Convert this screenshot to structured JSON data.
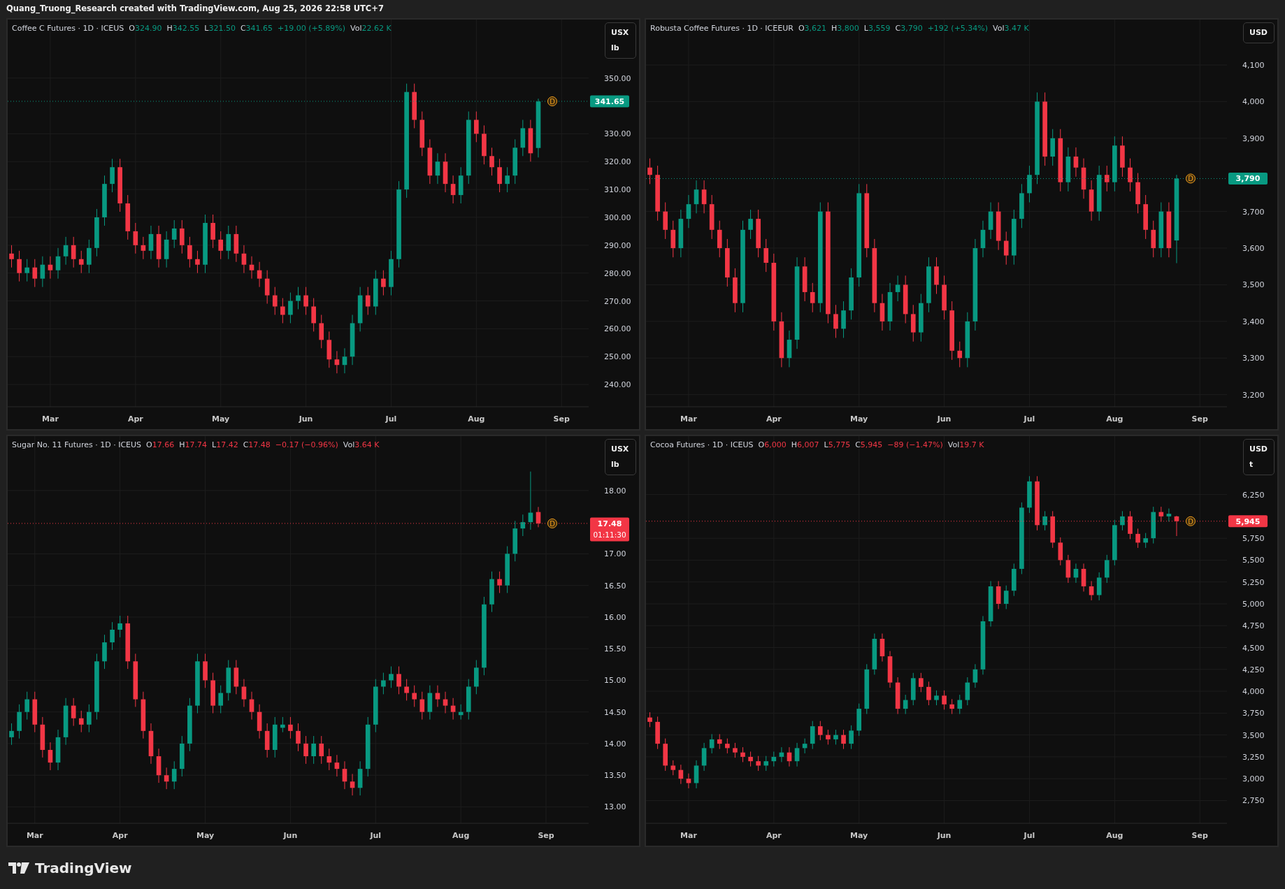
{
  "header": {
    "title": "Quang_Truong_Research created with TradingView.com, Aug 25, 2026 22:58 UTC+7"
  },
  "panels": [
    {
      "symbol": "Coffee C Futures · 1D · ICEUS",
      "rising": true,
      "ohlc": [
        {
          "label": "O",
          "value": "324.90"
        },
        {
          "label": "H",
          "value": "342.55"
        },
        {
          "label": "L",
          "value": "321.50"
        },
        {
          "label": "C",
          "value": "341.65"
        }
      ],
      "change": "+19.00 (+5.89%)",
      "volume_label": "Vol",
      "volume": "22.62 K",
      "currency": "USX",
      "unit": "lb",
      "marker": "D",
      "chart_data": {
        "type": "candlestick",
        "grid": true,
        "ylim": [
          232,
          371
        ],
        "categories": [
          null,
          null,
          null,
          null,
          null,
          "Mar",
          null,
          null,
          null,
          null,
          null,
          null,
          null,
          null,
          null,
          null,
          "Apr",
          null,
          null,
          null,
          null,
          null,
          null,
          null,
          null,
          null,
          null,
          "May",
          null,
          null,
          null,
          null,
          null,
          null,
          null,
          null,
          null,
          null,
          "Jun",
          null,
          null,
          null,
          null,
          null,
          null,
          null,
          null,
          null,
          null,
          "Jul",
          null,
          null,
          null,
          null,
          null,
          null,
          null,
          null,
          null,
          null,
          "Aug",
          null,
          null,
          null,
          null,
          null,
          null,
          null,
          null,
          null,
          null,
          "Sep",
          null,
          null,
          null
        ],
        "yticks": [
          {
            "value": 240,
            "label": "240.00"
          },
          {
            "value": 250,
            "label": "250.00"
          },
          {
            "value": 260,
            "label": "260.00"
          },
          {
            "value": 270,
            "label": "270.00"
          },
          {
            "value": 280,
            "label": "280.00"
          },
          {
            "value": 290,
            "label": "290.00"
          },
          {
            "value": 300,
            "label": "300.00"
          },
          {
            "value": 310,
            "label": "310.00"
          },
          {
            "value": 320,
            "label": "320.00"
          },
          {
            "value": 330,
            "label": "330.00"
          },
          {
            "value": 350,
            "label": "350.00"
          }
        ],
        "ref_lines": [
          {
            "axis": "y",
            "value": 341.65,
            "label": "341.65"
          }
        ],
        "ohlc": [
          [
            287,
            290,
            282,
            285
          ],
          [
            285,
            288,
            277,
            280
          ],
          [
            280,
            285,
            277,
            282
          ],
          [
            282,
            285,
            275,
            278
          ],
          [
            278,
            286,
            275,
            283
          ],
          [
            283,
            286,
            278,
            281
          ],
          [
            281,
            289,
            278,
            286
          ],
          [
            286,
            293,
            283,
            290
          ],
          [
            290,
            293,
            282,
            285
          ],
          [
            285,
            288,
            280,
            283
          ],
          [
            283,
            292,
            280,
            289
          ],
          [
            289,
            303,
            286,
            300
          ],
          [
            300,
            315,
            297,
            312
          ],
          [
            312,
            321,
            309,
            318
          ],
          [
            318,
            321,
            302,
            305
          ],
          [
            305,
            308,
            292,
            295
          ],
          [
            295,
            298,
            287,
            290
          ],
          [
            290,
            293,
            285,
            288
          ],
          [
            288,
            297,
            285,
            294
          ],
          [
            294,
            297,
            282,
            285
          ],
          [
            285,
            295,
            282,
            292
          ],
          [
            292,
            299,
            289,
            296
          ],
          [
            296,
            299,
            287,
            290
          ],
          [
            290,
            293,
            282,
            285
          ],
          [
            285,
            288,
            280,
            283
          ],
          [
            283,
            301,
            280,
            298
          ],
          [
            298,
            301,
            289,
            292
          ],
          [
            292,
            295,
            285,
            288
          ],
          [
            288,
            297,
            285,
            294
          ],
          [
            294,
            297,
            284,
            287
          ],
          [
            287,
            290,
            280,
            283
          ],
          [
            283,
            286,
            278,
            281
          ],
          [
            281,
            284,
            275,
            278
          ],
          [
            278,
            281,
            269,
            272
          ],
          [
            272,
            275,
            265,
            268
          ],
          [
            268,
            271,
            262,
            265
          ],
          [
            265,
            273,
            262,
            270
          ],
          [
            270,
            275,
            267,
            272
          ],
          [
            272,
            275,
            265,
            268
          ],
          [
            268,
            271,
            259,
            262
          ],
          [
            262,
            265,
            253,
            256
          ],
          [
            256,
            259,
            246,
            249
          ],
          [
            249,
            252,
            244,
            247
          ],
          [
            247,
            253,
            244,
            250
          ],
          [
            250,
            265,
            247,
            262
          ],
          [
            262,
            275,
            259,
            272
          ],
          [
            272,
            275,
            265,
            268
          ],
          [
            268,
            281,
            265,
            278
          ],
          [
            278,
            281,
            272,
            275
          ],
          [
            275,
            288,
            272,
            285
          ],
          [
            285,
            313,
            282,
            310
          ],
          [
            310,
            348,
            307,
            345
          ],
          [
            345,
            348,
            332,
            335
          ],
          [
            335,
            338,
            322,
            325
          ],
          [
            325,
            328,
            312,
            315
          ],
          [
            315,
            323,
            312,
            320
          ],
          [
            320,
            323,
            309,
            312
          ],
          [
            312,
            315,
            305,
            308
          ],
          [
            308,
            318,
            305,
            315
          ],
          [
            315,
            338,
            312,
            335
          ],
          [
            335,
            338,
            327,
            330
          ],
          [
            330,
            333,
            319,
            322
          ],
          [
            322,
            325,
            315,
            318
          ],
          [
            318,
            321,
            309,
            312
          ],
          [
            312,
            318,
            309,
            315
          ],
          [
            315,
            328,
            312,
            325
          ],
          [
            325,
            335,
            322,
            332
          ],
          [
            332,
            335,
            320,
            323
          ],
          [
            324.9,
            342.6,
            321.5,
            341.6
          ],
          null,
          null,
          null,
          null,
          null,
          null
        ]
      }
    },
    {
      "symbol": "Robusta Coffee Futures · 1D · ICEEUR",
      "rising": true,
      "ohlc": [
        {
          "label": "O",
          "value": "3,621"
        },
        {
          "label": "H",
          "value": "3,800"
        },
        {
          "label": "L",
          "value": "3,559"
        },
        {
          "label": "C",
          "value": "3,790"
        }
      ],
      "change": "+192 (+5.34%)",
      "volume_label": "Vol",
      "volume": "3.47 K",
      "currency": "USD",
      "marker": "D",
      "chart_data": {
        "type": "candlestick",
        "grid": true,
        "ylim": [
          3167,
          4224
        ],
        "categories": [
          null,
          null,
          null,
          null,
          null,
          "Mar",
          null,
          null,
          null,
          null,
          null,
          null,
          null,
          null,
          null,
          null,
          "Apr",
          null,
          null,
          null,
          null,
          null,
          null,
          null,
          null,
          null,
          null,
          "May",
          null,
          null,
          null,
          null,
          null,
          null,
          null,
          null,
          null,
          null,
          "Jun",
          null,
          null,
          null,
          null,
          null,
          null,
          null,
          null,
          null,
          null,
          "Jul",
          null,
          null,
          null,
          null,
          null,
          null,
          null,
          null,
          null,
          null,
          "Aug",
          null,
          null,
          null,
          null,
          null,
          null,
          null,
          null,
          null,
          null,
          "Sep",
          null,
          null,
          null
        ],
        "yticks": [
          {
            "value": 3200,
            "label": "3,200"
          },
          {
            "value": 3300,
            "label": "3,300"
          },
          {
            "value": 3400,
            "label": "3,400"
          },
          {
            "value": 3500,
            "label": "3,500"
          },
          {
            "value": 3600,
            "label": "3,600"
          },
          {
            "value": 3700,
            "label": "3,700"
          },
          {
            "value": 3900,
            "label": "3,900"
          },
          {
            "value": 4000,
            "label": "4,000"
          },
          {
            "value": 4100,
            "label": "4,100"
          }
        ],
        "ref_lines": [
          {
            "axis": "y",
            "value": 3790,
            "label": "3,790"
          }
        ],
        "ohlc": [
          [
            3820,
            3845,
            3775,
            3800
          ],
          [
            3800,
            3825,
            3675,
            3700
          ],
          [
            3700,
            3725,
            3625,
            3650
          ],
          [
            3650,
            3675,
            3575,
            3600
          ],
          [
            3600,
            3705,
            3575,
            3680
          ],
          [
            3680,
            3745,
            3655,
            3720
          ],
          [
            3720,
            3785,
            3695,
            3760
          ],
          [
            3760,
            3785,
            3695,
            3720
          ],
          [
            3720,
            3745,
            3625,
            3650
          ],
          [
            3650,
            3675,
            3575,
            3600
          ],
          [
            3600,
            3625,
            3495,
            3520
          ],
          [
            3520,
            3545,
            3425,
            3450
          ],
          [
            3450,
            3675,
            3425,
            3650
          ],
          [
            3650,
            3705,
            3625,
            3680
          ],
          [
            3680,
            3705,
            3575,
            3600
          ],
          [
            3600,
            3625,
            3535,
            3560
          ],
          [
            3560,
            3585,
            3375,
            3400
          ],
          [
            3400,
            3425,
            3275,
            3300
          ],
          [
            3300,
            3375,
            3275,
            3350
          ],
          [
            3350,
            3575,
            3325,
            3550
          ],
          [
            3550,
            3575,
            3455,
            3480
          ],
          [
            3480,
            3505,
            3425,
            3450
          ],
          [
            3450,
            3725,
            3425,
            3700
          ],
          [
            3700,
            3725,
            3395,
            3420
          ],
          [
            3420,
            3445,
            3355,
            3380
          ],
          [
            3380,
            3455,
            3355,
            3430
          ],
          [
            3430,
            3545,
            3405,
            3520
          ],
          [
            3520,
            3775,
            3495,
            3750
          ],
          [
            3750,
            3775,
            3575,
            3600
          ],
          [
            3600,
            3625,
            3425,
            3450
          ],
          [
            3450,
            3475,
            3375,
            3400
          ],
          [
            3400,
            3505,
            3375,
            3480
          ],
          [
            3480,
            3525,
            3455,
            3500
          ],
          [
            3500,
            3525,
            3395,
            3420
          ],
          [
            3420,
            3445,
            3345,
            3370
          ],
          [
            3370,
            3475,
            3345,
            3450
          ],
          [
            3450,
            3575,
            3425,
            3550
          ],
          [
            3550,
            3575,
            3475,
            3500
          ],
          [
            3500,
            3525,
            3405,
            3430
          ],
          [
            3430,
            3455,
            3295,
            3320
          ],
          [
            3320,
            3345,
            3275,
            3300
          ],
          [
            3300,
            3425,
            3275,
            3400
          ],
          [
            3400,
            3625,
            3375,
            3600
          ],
          [
            3600,
            3675,
            3575,
            3650
          ],
          [
            3650,
            3725,
            3625,
            3700
          ],
          [
            3700,
            3725,
            3595,
            3620
          ],
          [
            3620,
            3645,
            3555,
            3580
          ],
          [
            3580,
            3705,
            3555,
            3680
          ],
          [
            3680,
            3775,
            3655,
            3750
          ],
          [
            3750,
            3825,
            3725,
            3800
          ],
          [
            3800,
            4025,
            3775,
            4000
          ],
          [
            4000,
            4025,
            3825,
            3850
          ],
          [
            3850,
            3925,
            3825,
            3900
          ],
          [
            3900,
            3925,
            3755,
            3780
          ],
          [
            3780,
            3875,
            3755,
            3850
          ],
          [
            3850,
            3875,
            3795,
            3820
          ],
          [
            3820,
            3845,
            3735,
            3760
          ],
          [
            3760,
            3785,
            3675,
            3700
          ],
          [
            3700,
            3825,
            3675,
            3800
          ],
          [
            3800,
            3825,
            3755,
            3780
          ],
          [
            3780,
            3905,
            3755,
            3880
          ],
          [
            3880,
            3905,
            3795,
            3820
          ],
          [
            3820,
            3845,
            3755,
            3780
          ],
          [
            3780,
            3805,
            3695,
            3720
          ],
          [
            3720,
            3745,
            3625,
            3650
          ],
          [
            3650,
            3675,
            3575,
            3600
          ],
          [
            3600,
            3725,
            3575,
            3700
          ],
          [
            3700,
            3725,
            3575,
            3600
          ],
          [
            3621,
            3800,
            3559,
            3790
          ],
          null,
          null,
          null,
          null,
          null,
          null
        ]
      }
    },
    {
      "symbol": "Sugar No. 11 Futures · 1D · ICEUS",
      "rising": false,
      "ohlc": [
        {
          "label": "O",
          "value": "17.66"
        },
        {
          "label": "H",
          "value": "17.74"
        },
        {
          "label": "L",
          "value": "17.42"
        },
        {
          "label": "C",
          "value": "17.48"
        }
      ],
      "change": "−0.17 (−0.96%)",
      "volume_label": "Vol",
      "volume": "3.64 K",
      "currency": "USX",
      "unit": "lb",
      "countdown": "01:11:30",
      "marker": "D",
      "chart_data": {
        "type": "candlestick",
        "grid": true,
        "ylim": [
          12.74,
          18.86
        ],
        "categories": [
          null,
          null,
          null,
          "Mar",
          null,
          null,
          null,
          null,
          null,
          null,
          null,
          null,
          null,
          null,
          "Apr",
          null,
          null,
          null,
          null,
          null,
          null,
          null,
          null,
          null,
          null,
          "May",
          null,
          null,
          null,
          null,
          null,
          null,
          null,
          null,
          null,
          null,
          "Jun",
          null,
          null,
          null,
          null,
          null,
          null,
          null,
          null,
          null,
          null,
          "Jul",
          null,
          null,
          null,
          null,
          null,
          null,
          null,
          null,
          null,
          null,
          "Aug",
          null,
          null,
          null,
          null,
          null,
          null,
          null,
          null,
          null,
          null,
          "Sep",
          null,
          null,
          null,
          null,
          null
        ],
        "yticks": [
          {
            "value": 13,
            "label": "13.00"
          },
          {
            "value": 13.5,
            "label": "13.50"
          },
          {
            "value": 14,
            "label": "14.00"
          },
          {
            "value": 14.5,
            "label": "14.50"
          },
          {
            "value": 15,
            "label": "15.00"
          },
          {
            "value": 15.5,
            "label": "15.50"
          },
          {
            "value": 16,
            "label": "16.00"
          },
          {
            "value": 16.5,
            "label": "16.50"
          },
          {
            "value": 17,
            "label": "17.00"
          },
          {
            "value": 18,
            "label": "18.00"
          }
        ],
        "ref_lines": [
          {
            "axis": "y",
            "value": 17.48,
            "label": "17.48"
          }
        ],
        "ohlc": [
          [
            14.1,
            14.32,
            13.98,
            14.2
          ],
          [
            14.2,
            14.62,
            14.08,
            14.5
          ],
          [
            14.5,
            14.82,
            14.38,
            14.7
          ],
          [
            14.7,
            14.82,
            14.18,
            14.3
          ],
          [
            14.3,
            14.42,
            13.78,
            13.9
          ],
          [
            13.9,
            14.02,
            13.58,
            13.7
          ],
          [
            13.7,
            14.22,
            13.58,
            14.1
          ],
          [
            14.1,
            14.72,
            13.98,
            14.6
          ],
          [
            14.6,
            14.72,
            14.28,
            14.4
          ],
          [
            14.4,
            14.52,
            14.18,
            14.3
          ],
          [
            14.3,
            14.62,
            14.18,
            14.5
          ],
          [
            14.5,
            15.42,
            14.38,
            15.3
          ],
          [
            15.3,
            15.72,
            15.18,
            15.6
          ],
          [
            15.6,
            15.92,
            15.48,
            15.8
          ],
          [
            15.8,
            16.02,
            15.68,
            15.9
          ],
          [
            15.9,
            16.02,
            15.18,
            15.3
          ],
          [
            15.3,
            15.42,
            14.58,
            14.7
          ],
          [
            14.7,
            14.82,
            14.08,
            14.2
          ],
          [
            14.2,
            14.32,
            13.68,
            13.8
          ],
          [
            13.8,
            13.92,
            13.38,
            13.5
          ],
          [
            13.5,
            13.62,
            13.28,
            13.4
          ],
          [
            13.4,
            13.72,
            13.28,
            13.6
          ],
          [
            13.6,
            14.12,
            13.48,
            14.0
          ],
          [
            14.0,
            14.72,
            13.88,
            14.6
          ],
          [
            14.6,
            15.42,
            14.48,
            15.3
          ],
          [
            15.3,
            15.42,
            14.88,
            15.0
          ],
          [
            15.0,
            15.12,
            14.48,
            14.6
          ],
          [
            14.6,
            14.92,
            14.48,
            14.8
          ],
          [
            14.8,
            15.32,
            14.68,
            15.2
          ],
          [
            15.2,
            15.32,
            14.78,
            14.9
          ],
          [
            14.9,
            15.02,
            14.58,
            14.7
          ],
          [
            14.7,
            14.82,
            14.38,
            14.5
          ],
          [
            14.5,
            14.62,
            14.08,
            14.2
          ],
          [
            14.2,
            14.32,
            13.78,
            13.9
          ],
          [
            13.9,
            14.42,
            13.78,
            14.3
          ],
          [
            14.25,
            14.42,
            14.18,
            14.3
          ],
          [
            14.3,
            14.42,
            14.08,
            14.2
          ],
          [
            14.2,
            14.32,
            13.88,
            14.0
          ],
          [
            14.0,
            14.12,
            13.68,
            13.8
          ],
          [
            13.8,
            14.12,
            13.68,
            14.0
          ],
          [
            14.0,
            14.12,
            13.68,
            13.8
          ],
          [
            13.8,
            13.92,
            13.58,
            13.7
          ],
          [
            13.7,
            13.82,
            13.48,
            13.6
          ],
          [
            13.6,
            13.72,
            13.28,
            13.4
          ],
          [
            13.4,
            13.52,
            13.18,
            13.3
          ],
          [
            13.3,
            13.72,
            13.18,
            13.6
          ],
          [
            13.6,
            14.42,
            13.48,
            14.3
          ],
          [
            14.3,
            15.02,
            14.18,
            14.9
          ],
          [
            14.9,
            15.12,
            14.78,
            15.0
          ],
          [
            15.0,
            15.22,
            14.88,
            15.1
          ],
          [
            15.1,
            15.22,
            14.78,
            14.9
          ],
          [
            14.9,
            15.02,
            14.68,
            14.8
          ],
          [
            14.8,
            14.92,
            14.58,
            14.7
          ],
          [
            14.7,
            14.82,
            14.38,
            14.5
          ],
          [
            14.5,
            14.92,
            14.38,
            14.8
          ],
          [
            14.8,
            14.92,
            14.58,
            14.7
          ],
          [
            14.7,
            14.82,
            14.48,
            14.6
          ],
          [
            14.6,
            14.72,
            14.38,
            14.5
          ],
          [
            14.45,
            14.62,
            14.38,
            14.5
          ],
          [
            14.5,
            15.02,
            14.38,
            14.9
          ],
          [
            14.9,
            15.32,
            14.78,
            15.2
          ],
          [
            15.2,
            16.32,
            15.08,
            16.2
          ],
          [
            16.2,
            16.72,
            16.08,
            16.6
          ],
          [
            16.6,
            16.72,
            16.38,
            16.5
          ],
          [
            16.5,
            17.12,
            16.38,
            17.0
          ],
          [
            17.0,
            17.52,
            16.88,
            17.4
          ],
          [
            17.4,
            17.62,
            17.28,
            17.5
          ],
          [
            17.5,
            18.3,
            17.38,
            17.65
          ],
          [
            17.66,
            17.74,
            17.42,
            17.48
          ],
          null,
          null,
          null,
          null,
          null,
          null
        ]
      }
    },
    {
      "symbol": "Cocoa Futures · 1D · ICEUS",
      "rising": false,
      "ohlc": [
        {
          "label": "O",
          "value": "6,000"
        },
        {
          "label": "H",
          "value": "6,007"
        },
        {
          "label": "L",
          "value": "5,775"
        },
        {
          "label": "C",
          "value": "5,945"
        }
      ],
      "change": "−89 (−1.47%)",
      "volume_label": "Vol",
      "volume": "19.7 K",
      "currency": "USD",
      "unit": "t",
      "marker": "D",
      "chart_data": {
        "type": "candlestick",
        "grid": true,
        "ylim": [
          2490,
          6918
        ],
        "categories": [
          null,
          null,
          null,
          null,
          null,
          "Mar",
          null,
          null,
          null,
          null,
          null,
          null,
          null,
          null,
          null,
          null,
          "Apr",
          null,
          null,
          null,
          null,
          null,
          null,
          null,
          null,
          null,
          null,
          "May",
          null,
          null,
          null,
          null,
          null,
          null,
          null,
          null,
          null,
          null,
          "Jun",
          null,
          null,
          null,
          null,
          null,
          null,
          null,
          null,
          null,
          null,
          "Jul",
          null,
          null,
          null,
          null,
          null,
          null,
          null,
          null,
          null,
          null,
          "Aug",
          null,
          null,
          null,
          null,
          null,
          null,
          null,
          null,
          null,
          null,
          "Sep",
          null,
          null,
          null
        ],
        "yticks": [
          {
            "value": 2750,
            "label": "2,750"
          },
          {
            "value": 3000,
            "label": "3,000"
          },
          {
            "value": 3250,
            "label": "3,250"
          },
          {
            "value": 3500,
            "label": "3,500"
          },
          {
            "value": 3750,
            "label": "3,750"
          },
          {
            "value": 4000,
            "label": "4,000"
          },
          {
            "value": 4250,
            "label": "4,250"
          },
          {
            "value": 4500,
            "label": "4,500"
          },
          {
            "value": 4750,
            "label": "4,750"
          },
          {
            "value": 5000,
            "label": "5,000"
          },
          {
            "value": 5250,
            "label": "5,250"
          },
          {
            "value": 5500,
            "label": "5,500"
          },
          {
            "value": 5750,
            "label": "5,750"
          },
          {
            "value": 6250,
            "label": "6,250"
          }
        ],
        "ref_lines": [
          {
            "axis": "y",
            "value": 5945,
            "label": "5,945"
          }
        ],
        "ohlc": [
          [
            3700,
            3760,
            3590,
            3650
          ],
          [
            3650,
            3710,
            3340,
            3400
          ],
          [
            3400,
            3460,
            3090,
            3150
          ],
          [
            3150,
            3210,
            3040,
            3100
          ],
          [
            3100,
            3160,
            2940,
            3000
          ],
          [
            3000,
            3060,
            2890,
            2950
          ],
          [
            2950,
            3210,
            2890,
            3150
          ],
          [
            3150,
            3410,
            3090,
            3350
          ],
          [
            3350,
            3510,
            3290,
            3450
          ],
          [
            3450,
            3510,
            3340,
            3400
          ],
          [
            3400,
            3460,
            3290,
            3350
          ],
          [
            3350,
            3410,
            3240,
            3300
          ],
          [
            3300,
            3360,
            3190,
            3250
          ],
          [
            3250,
            3310,
            3140,
            3200
          ],
          [
            3200,
            3260,
            3090,
            3150
          ],
          [
            3150,
            3260,
            3090,
            3200
          ],
          [
            3200,
            3310,
            3140,
            3250
          ],
          [
            3250,
            3360,
            3190,
            3300
          ],
          [
            3300,
            3360,
            3140,
            3200
          ],
          [
            3200,
            3410,
            3140,
            3350
          ],
          [
            3350,
            3460,
            3290,
            3400
          ],
          [
            3400,
            3660,
            3340,
            3600
          ],
          [
            3600,
            3660,
            3440,
            3500
          ],
          [
            3500,
            3560,
            3390,
            3450
          ],
          [
            3450,
            3560,
            3390,
            3500
          ],
          [
            3500,
            3560,
            3340,
            3400
          ],
          [
            3400,
            3610,
            3340,
            3550
          ],
          [
            3550,
            3860,
            3490,
            3800
          ],
          [
            3800,
            4310,
            3740,
            4250
          ],
          [
            4250,
            4660,
            4190,
            4600
          ],
          [
            4600,
            4660,
            4340,
            4400
          ],
          [
            4400,
            4460,
            4040,
            4100
          ],
          [
            4100,
            4160,
            3740,
            3800
          ],
          [
            3800,
            3960,
            3740,
            3900
          ],
          [
            3900,
            4210,
            3840,
            4150
          ],
          [
            4150,
            4210,
            3990,
            4050
          ],
          [
            4050,
            4110,
            3840,
            3900
          ],
          [
            3900,
            4010,
            3840,
            3950
          ],
          [
            3950,
            4010,
            3790,
            3850
          ],
          [
            3850,
            3910,
            3740,
            3800
          ],
          [
            3800,
            3960,
            3740,
            3900
          ],
          [
            3900,
            4160,
            3840,
            4100
          ],
          [
            4100,
            4310,
            4040,
            4250
          ],
          [
            4250,
            4860,
            4190,
            4800
          ],
          [
            4800,
            5260,
            4740,
            5200
          ],
          [
            5200,
            5260,
            4940,
            5000
          ],
          [
            5000,
            5210,
            4940,
            5150
          ],
          [
            5150,
            5460,
            5090,
            5400
          ],
          [
            5400,
            6160,
            5340,
            6100
          ],
          [
            6100,
            6460,
            6040,
            6400
          ],
          [
            6400,
            6460,
            5840,
            5900
          ],
          [
            5900,
            6060,
            5840,
            6000
          ],
          [
            6000,
            6060,
            5640,
            5700
          ],
          [
            5700,
            5760,
            5440,
            5500
          ],
          [
            5500,
            5560,
            5240,
            5300
          ],
          [
            5300,
            5460,
            5240,
            5400
          ],
          [
            5400,
            5460,
            5140,
            5200
          ],
          [
            5200,
            5260,
            5040,
            5100
          ],
          [
            5100,
            5360,
            5040,
            5300
          ],
          [
            5300,
            5560,
            5240,
            5500
          ],
          [
            5500,
            5960,
            5440,
            5900
          ],
          [
            5900,
            6060,
            5840,
            6000
          ],
          [
            6000,
            6060,
            5740,
            5800
          ],
          [
            5800,
            5860,
            5640,
            5700
          ],
          [
            5700,
            5810,
            5640,
            5750
          ],
          [
            5750,
            6110,
            5690,
            6050
          ],
          [
            6050,
            6110,
            5940,
            6000
          ],
          [
            6000,
            6090,
            5940,
            6030
          ],
          [
            6000,
            6007,
            5775,
            5945
          ],
          null,
          null,
          null,
          null,
          null,
          null
        ]
      }
    }
  ],
  "footer": {
    "brand": "TradingView"
  }
}
